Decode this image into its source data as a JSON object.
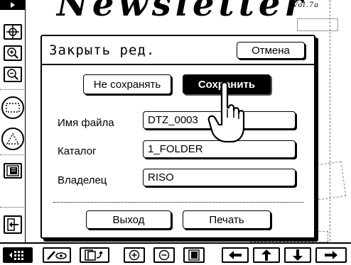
{
  "background": {
    "title": "Newsletter",
    "volume": "Vol.7a"
  },
  "sidebar": {
    "tools": [
      "move-icon",
      "zoom-in-icon",
      "zoom-out-icon",
      "rect-select-icon",
      "triangle-select-icon",
      "page-icon",
      "exit-icon"
    ]
  },
  "dialog": {
    "title": "Закрыть ред.",
    "cancel_label": "Отмена",
    "dont_save_label": "Не сохранять",
    "save_label": "Сохранить",
    "fields": {
      "filename": {
        "label": "Имя файла",
        "value": "DTZ_0003"
      },
      "folder": {
        "label": "Каталог",
        "value": "1_FOLDER"
      },
      "owner": {
        "label": "Владелец",
        "value": "RISO"
      }
    },
    "exit_label": "Выход",
    "print_label": "Печать"
  },
  "bottombar": {
    "tools": [
      "grid-icon",
      "eye-pencil-icon",
      "page-turn-icon",
      "zoom-in-icon",
      "zoom-out-icon",
      "page-icon",
      "arrow-left-icon",
      "arrow-up-icon",
      "arrow-down-icon",
      "arrow-right-icon"
    ]
  }
}
